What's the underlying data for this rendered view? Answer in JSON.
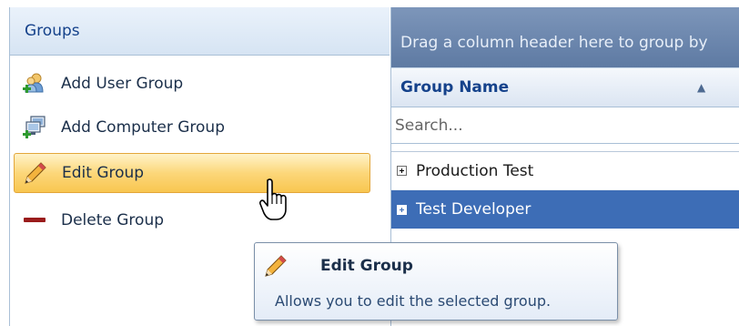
{
  "groups_panel": {
    "header": "Groups",
    "actions": [
      {
        "label": "Add User Group",
        "icon": "add-user-group-icon"
      },
      {
        "label": "Add Computer Group",
        "icon": "add-computer-group-icon"
      },
      {
        "label": "Edit Group",
        "icon": "pencil-icon",
        "selected": true
      },
      {
        "label": "Delete Group",
        "icon": "minus-icon"
      }
    ]
  },
  "grid": {
    "group_by_hint": "Drag a column header here to group by",
    "column_header": "Group Name",
    "sort_direction": "ascending",
    "search_placeholder": "Search...",
    "rows": [
      {
        "name": "Production Test",
        "selected": false
      },
      {
        "name": "Test Developer",
        "selected": true
      }
    ]
  },
  "tooltip": {
    "title": "Edit Group",
    "body": "Allows you to edit the selected group.",
    "icon": "pencil-icon"
  },
  "colors": {
    "selected_action_gradient": "#fcd77a",
    "selected_row": "#3d6db6",
    "header_text": "#15428b"
  }
}
